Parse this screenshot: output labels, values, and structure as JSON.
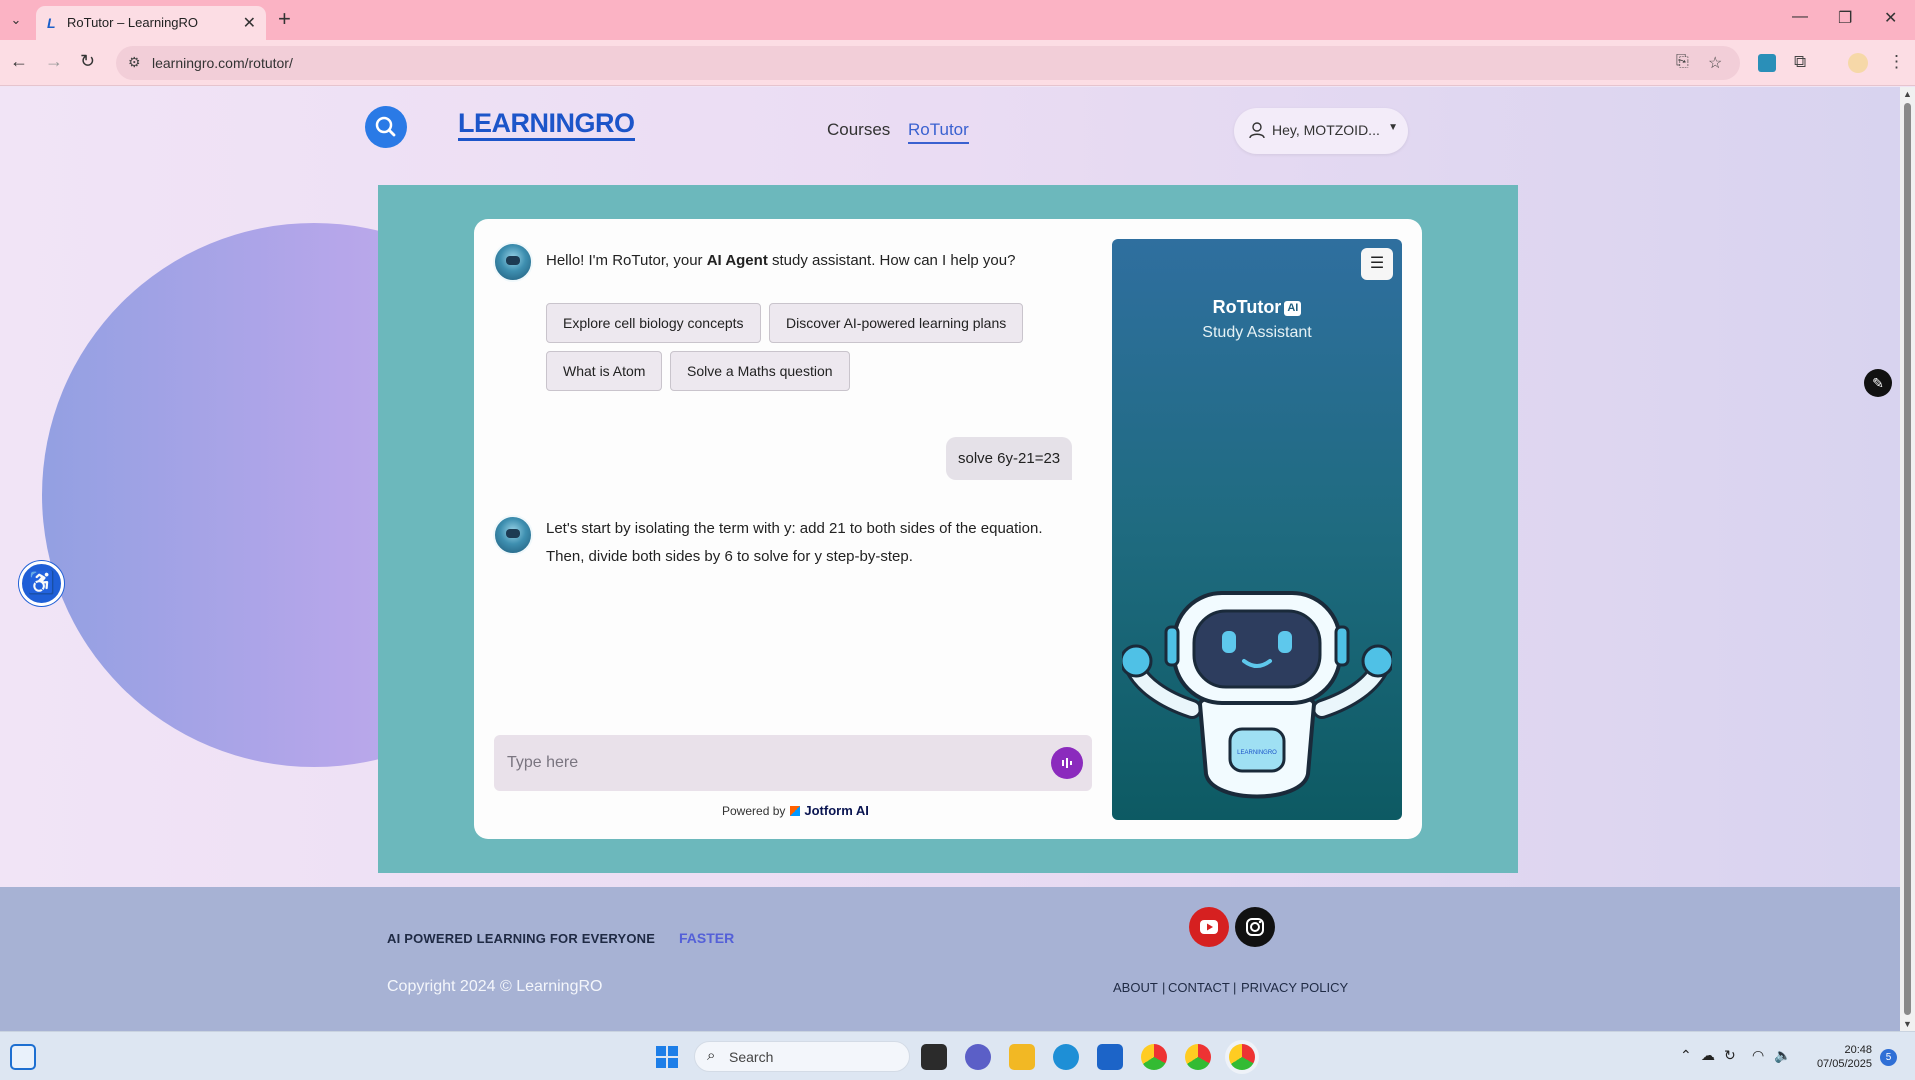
{
  "browser": {
    "tab_title": "RoTutor – LearningRO",
    "url": "learningro.com/rotutor/"
  },
  "header": {
    "logo": "LEARNINGRO",
    "nav": [
      {
        "label": "Courses"
      },
      {
        "label": "RoTutor"
      }
    ],
    "user_label": "Hey, MOTZOID..."
  },
  "chat": {
    "greeting_pre": "Hello! I'm RoTutor, your ",
    "greeting_bold": "AI Agent",
    "greeting_post": " study assistant. How can I help you?",
    "suggestions": [
      {
        "label": "Explore cell biology concepts"
      },
      {
        "label": "Discover AI-powered learning plans"
      },
      {
        "label": "What is Atom"
      },
      {
        "label": "Solve a Maths question"
      }
    ],
    "user_message": "solve 6y-21=23",
    "reply_line1": "Let's start by isolating the term with y: add 21 to both sides of the equation.",
    "reply_line2": "Then, divide both sides by 6 to solve for y step-by-step.",
    "input_placeholder": "Type here",
    "powered_by": "Powered by",
    "powered_brand": "Jotform AI"
  },
  "panel": {
    "title": "RoTutor",
    "badge": "AI",
    "subtitle": "Study Assistant",
    "robot_chest_text": "LEARNINGRO"
  },
  "footer": {
    "tagline": "AI POWERED LEARNING FOR EVERYONE",
    "tagline_accent": "FASTER",
    "copyright": "Copyright 2024 © LearningRO",
    "links": [
      {
        "label": "ABOUT"
      },
      {
        "label": "CONTACT"
      },
      {
        "label": "PRIVACY POLICY"
      }
    ]
  },
  "taskbar": {
    "search_label": "Search",
    "time": "20:48",
    "date": "07/05/2025",
    "notification_count": "5"
  },
  "colors": {
    "accent_blue": "#2a7ae6",
    "chat_section_bg": "#6cb8bc",
    "voice_button": "#8b2bbd",
    "youtube_red": "#d62020"
  },
  "icons": [
    "search-icon",
    "user-icon",
    "menu-icon",
    "microphone-icon",
    "accessibility-icon",
    "edit-icon",
    "youtube-icon",
    "instagram-icon"
  ]
}
